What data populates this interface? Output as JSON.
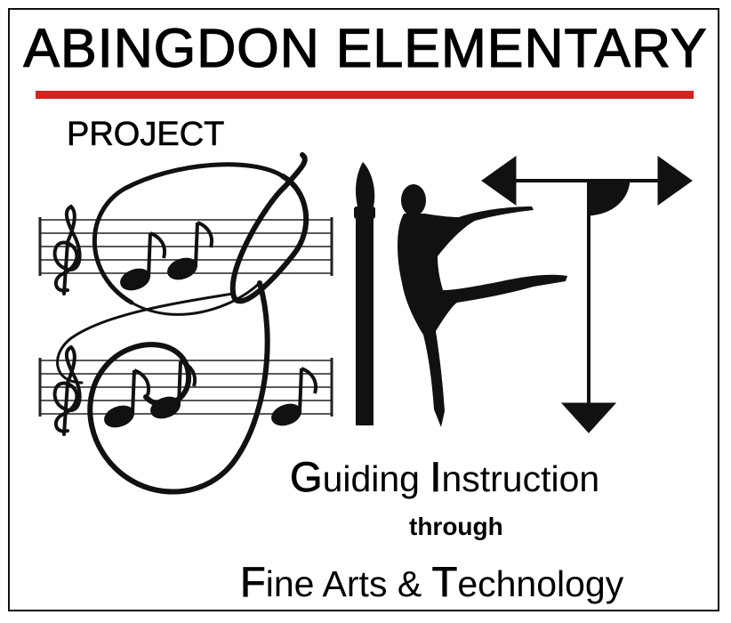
{
  "title": "ABINGDON ELEMENTARY",
  "project_label": "PROJECT",
  "accent_color": "#d42222",
  "logo": {
    "icons": [
      "treble-clef-staff-icon",
      "paintbrush-icon",
      "dancer-icon",
      "t-square-arrows-icon"
    ]
  },
  "tagline": {
    "line1": [
      {
        "cap": "G",
        "rest": "uiding "
      },
      {
        "cap": "I",
        "rest": "nstruction"
      }
    ],
    "line2": "through",
    "line3": [
      {
        "cap": "F",
        "rest": "ine Arts & "
      },
      {
        "cap": "T",
        "rest": "echnology"
      }
    ]
  }
}
